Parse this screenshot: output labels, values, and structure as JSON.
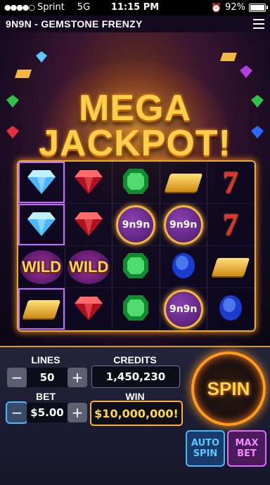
{
  "status": {
    "carrier": "Sprint",
    "network": "5G",
    "time": "11:15 PM",
    "battery": "92%",
    "battery_level": 0.92
  },
  "app": {
    "title": "9N9N - GEMSTONE FRENZY"
  },
  "banner": {
    "line1": "MEGA",
    "line2": "JACKPOT!"
  },
  "reels": {
    "rows": [
      [
        "diamond",
        "ruby",
        "emerald",
        "gold-stack",
        "seven"
      ],
      [
        "diamond",
        "ruby",
        "coin-9n9n",
        "coin-9n9n",
        "seven"
      ],
      [
        "wild",
        "wild",
        "emerald",
        "sapphire",
        "gold-bar"
      ],
      [
        "gold-bar",
        "ruby",
        "emerald",
        "coin-9n9n",
        "sapphire"
      ]
    ],
    "wild_label": "WILD",
    "coin_label": "9n9n",
    "seven_label": "7"
  },
  "controls": {
    "lines_label": "LINES",
    "lines_value": "50",
    "bet_label": "BET",
    "bet_value": "$5.00",
    "credits_label": "CREDITS",
    "credits_value": "1,450,230",
    "win_label": "WIN",
    "win_value": "$10,000,000!",
    "spin_label": "SPIN",
    "auto_line1": "AUTO",
    "auto_line2": "SPIN",
    "max_line1": "MAX",
    "max_line2": "BET",
    "minus": "−",
    "plus": "+"
  },
  "colors": {
    "accent_gold": "#ffcf4a",
    "spin_orange": "#ff9a1a",
    "auto_blue": "#4ab8ff",
    "max_purple": "#e06cff"
  }
}
